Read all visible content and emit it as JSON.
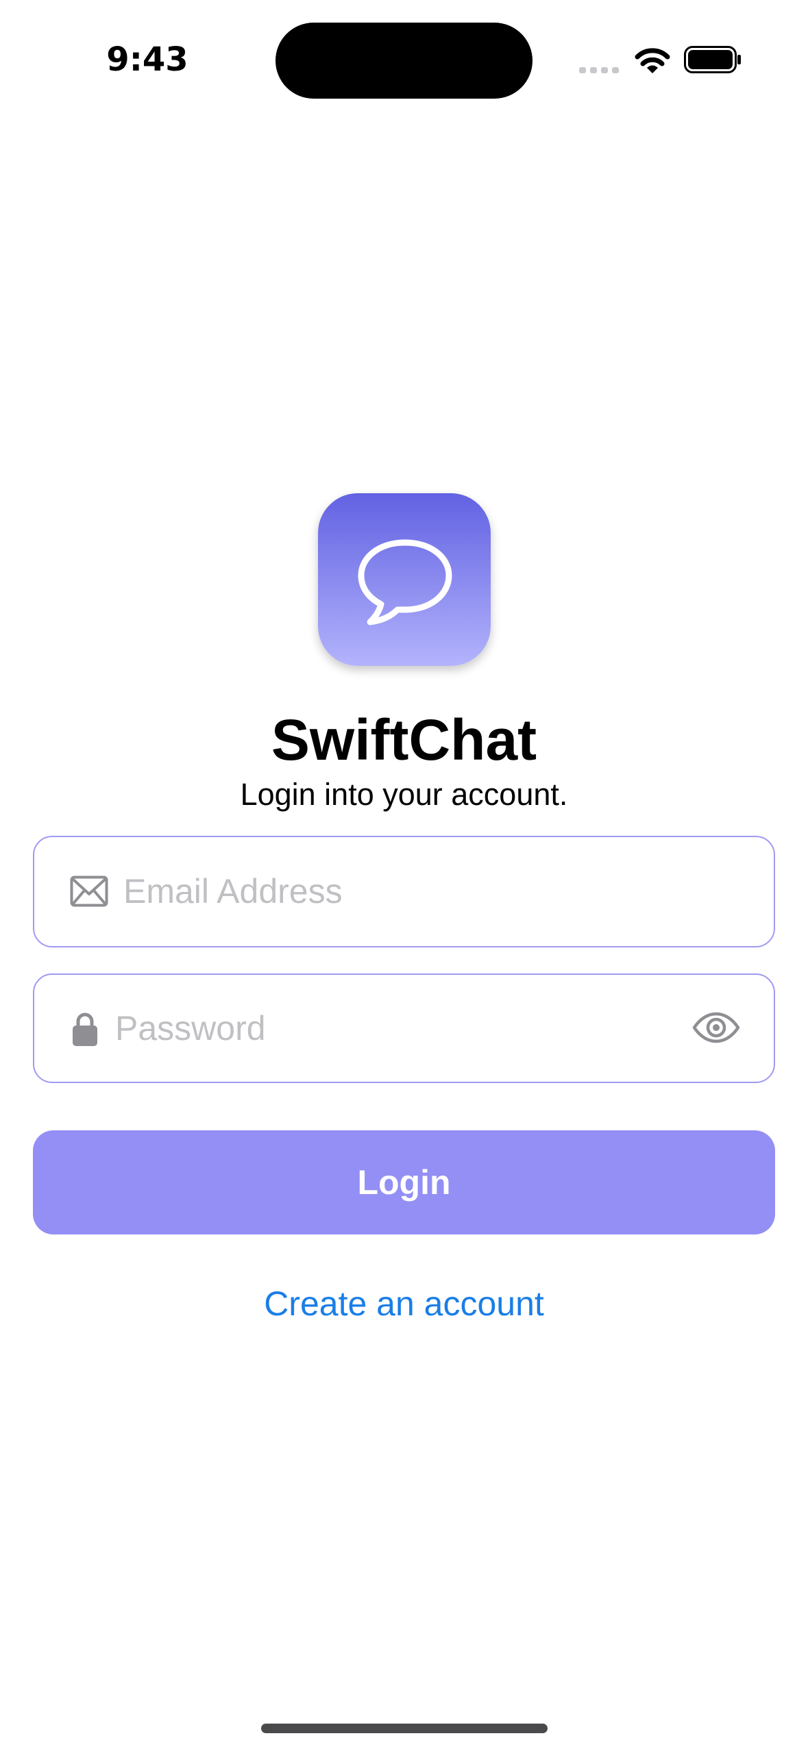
{
  "status_bar": {
    "time": "9:43",
    "icons": [
      "cellular-signal-icon",
      "wifi-icon",
      "battery-icon"
    ]
  },
  "app": {
    "logo_icon": "chat-bubble-icon",
    "name": "SwiftChat",
    "tagline": "Login into your account."
  },
  "form": {
    "email": {
      "icon": "envelope-icon",
      "value": "",
      "placeholder": "Email Address"
    },
    "password": {
      "icon": "lock-icon",
      "value": "",
      "placeholder": "Password",
      "toggle_icon": "eye-icon"
    },
    "login_label": "Login",
    "create_account_label": "Create an account"
  },
  "colors": {
    "accent": "#938ff5",
    "field_border": "#a09af2",
    "link": "#1a7ee6",
    "logo_gradient_top": "#6262e3",
    "logo_gradient_bottom": "#b3b3fd",
    "placeholder": "#c0c0c4",
    "icon_gray": "#8e8e93"
  }
}
